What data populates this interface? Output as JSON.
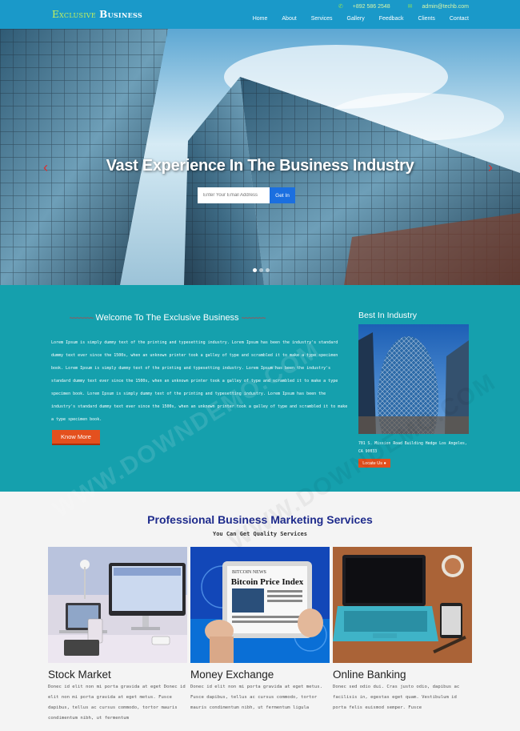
{
  "header": {
    "logo_part1": "Exclusive",
    "logo_part2": "Business",
    "phone": "+892 586 2548",
    "email": "admin@techb.com",
    "nav": [
      "Home",
      "About",
      "Services",
      "Gallery",
      "Feedback",
      "Clients",
      "Contact"
    ]
  },
  "hero": {
    "title": "Vast Experience In The Business Industry",
    "email_placeholder": "Enter Your Email Address",
    "submit_label": "Get In",
    "prev_arrow": "‹",
    "next_arrow": "›"
  },
  "welcome": {
    "deco_left": "~~~~~~~",
    "title": "Welcome To The Exclusive Business",
    "deco_right": "~~~~~~~",
    "text": "Lorem Ipsum is simply dummy text of the printing and typesetting industry. Lorem Ipsum has been the industry's standard dummy text ever since the 1500s, when an unknown printer took a galley of type and scrambled it to make a type specimen book. Lorem Ipsum is simply dummy text of the printing and typesetting industry. Lorem Ipsum has been the industry's standard dummy text ever since the 1500s, when an unknown printer took a galley of type and scrambled it to make a type specimen book. Lorem Ipsum is simply dummy text of the printing and typesetting industry. Lorem Ipsum has been the industry's standard dummy text ever since the 1500s, when an unknown printer took a galley of type and scrambled it to make a type specimen book.",
    "button": "Know More"
  },
  "best": {
    "title": "Best In Industry",
    "address": "701 S. Mission Road Building Hedge Los Angeles, CA 90033",
    "button": "Locate Us"
  },
  "services": {
    "title": "Professional Business Marketing Services",
    "subtitle": "You Can Get Quality Services",
    "cards": [
      {
        "title": "Stock Market",
        "text": "Donec id elit non mi porta gravida at eget Donec id elit non mi porta gravida at eget metus. Fusce dapibus, tellus ac cursus commodo, tortor mauris condimentum nibh, ut fermentum"
      },
      {
        "title": "Money Exchange",
        "text": "Donec id elit non mi porta gravida at eget metus. Fusce dapibus, tellus ac cursus commodo, tortor mauris condimentum nibh, ut fermentum ligula"
      },
      {
        "title": "Online Banking",
        "text": "Donec sed odio dui. Cras justo odio, dapibus ac facilisis in, egestas eget quam. Vestibulum id porta felis euismod semper. Fusce"
      }
    ],
    "newspaper_title": "Bitcoin Price Index",
    "newspaper_masthead": "BITCOIN NEWS"
  },
  "watermark": "WWW.DOWNDEMO.COM",
  "colors": {
    "header": "#1a99c9",
    "welcome_bg": "#15a0ad",
    "accent": "#e4501e",
    "services_title": "#1e2b8c"
  }
}
